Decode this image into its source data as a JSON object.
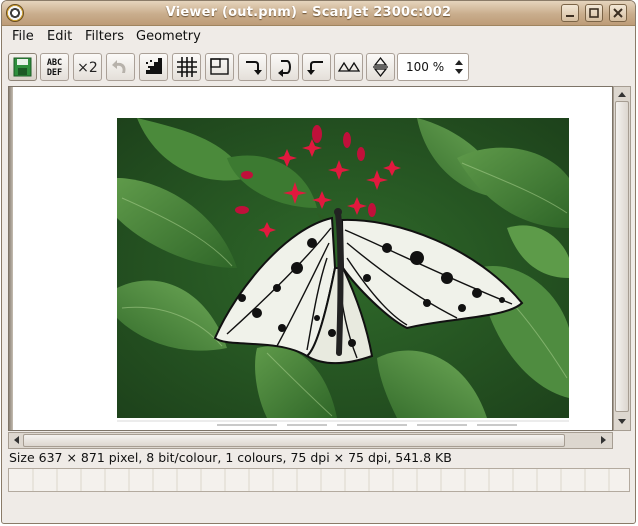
{
  "window": {
    "title": "Viewer (out.pnm) - ScanJet 2300c:002",
    "buttons": [
      "minimize-icon",
      "maximize-icon",
      "close-icon"
    ]
  },
  "menu": {
    "items": [
      "File",
      "Edit",
      "Filters",
      "Geometry"
    ]
  },
  "toolbar": {
    "icons": [
      "save-icon",
      "ocr-icon",
      "x2-icon",
      "undo-icon",
      "threshold-icon",
      "grid-icon",
      "crop-icon",
      "rotate-right-icon",
      "rotate-180-icon",
      "rotate-left-icon",
      "mirror-horizontal-icon",
      "mirror-vertical-icon"
    ],
    "ocr_label_top": "ABC",
    "ocr_label_bottom": "DEF",
    "x2_label": "×2"
  },
  "zoom": {
    "value": "100 %"
  },
  "status": {
    "text": "Size 637 × 871 pixel, 8 bit/colour, 1 colours, 75 dpi × 75 dpi, 541.8 KB"
  },
  "progress": {
    "fraction": 0
  },
  "colors": {
    "titlebar": "#c9ad8c",
    "window_bg": "#efebe7",
    "leaf_green": "#3e7a31",
    "flower_red": "#e2193e"
  }
}
